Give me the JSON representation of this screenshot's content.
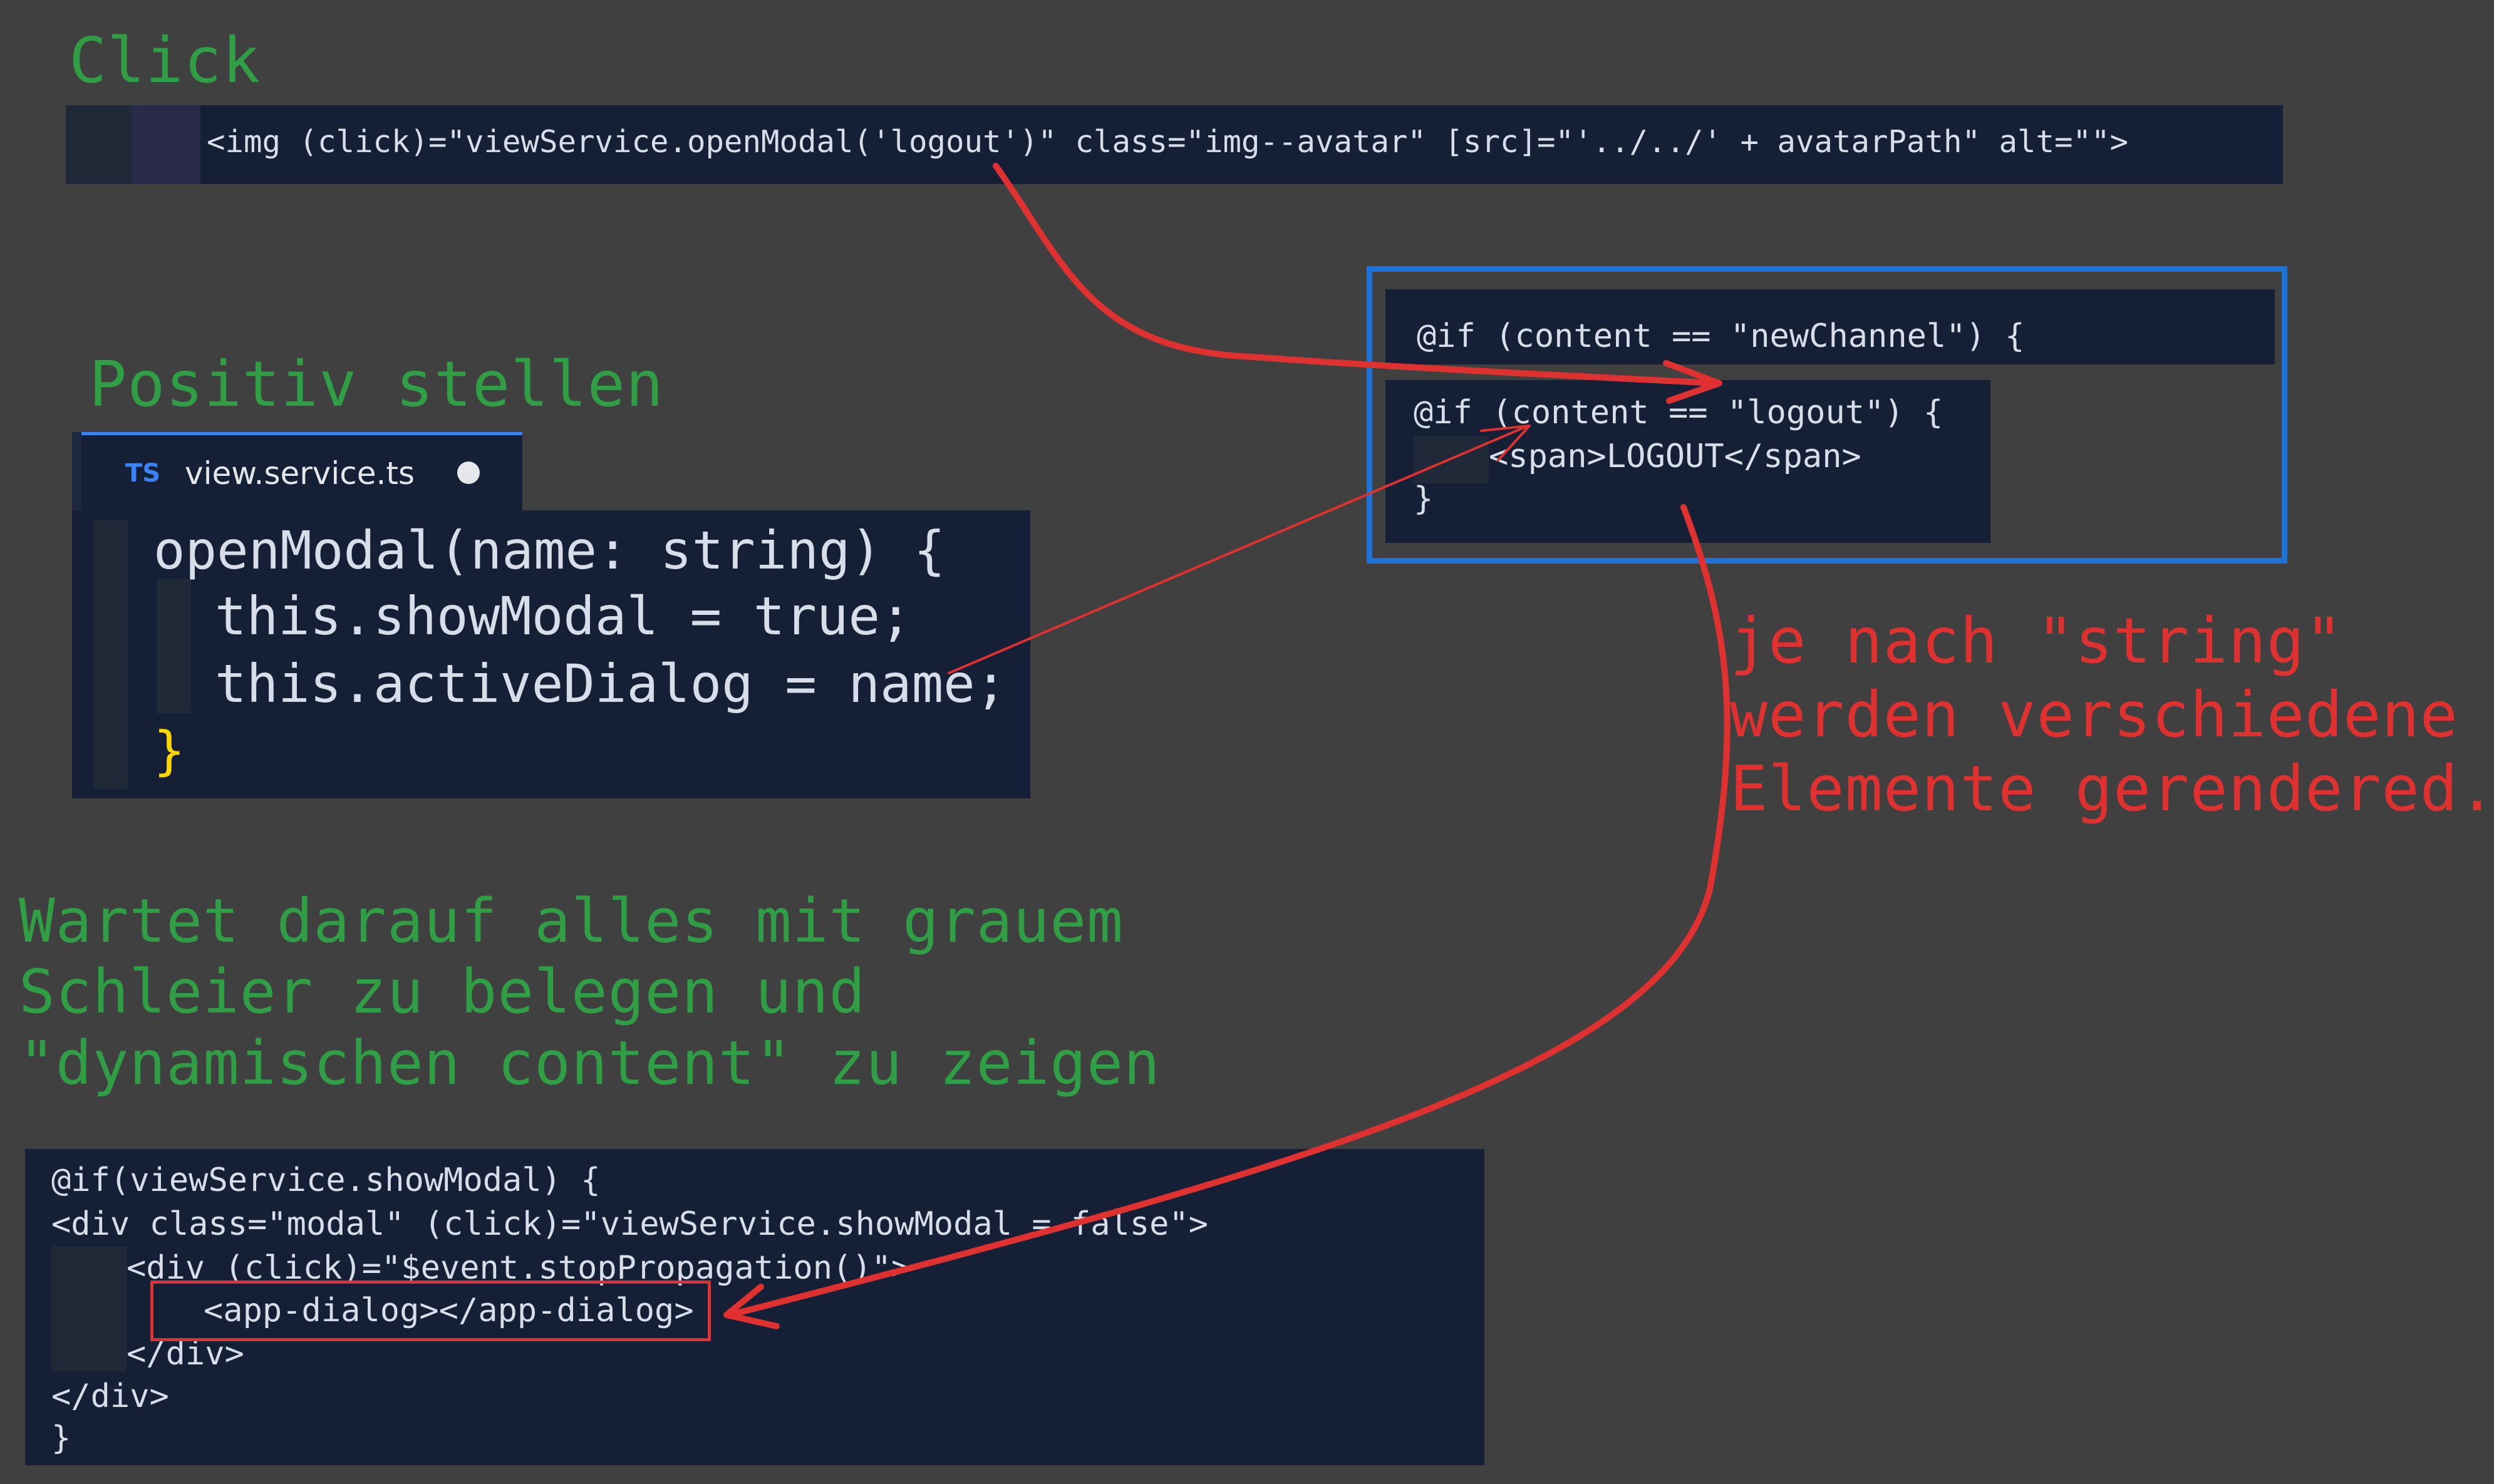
{
  "notes": {
    "click": "Click",
    "positiv": "Positiv stellen",
    "wartet": "Wartet darauf alles mit grauem\nSchleier zu belegen und\n\"dynamischen content\" zu zeigen",
    "je_nach": "je nach \"string\"\nwerden verschiedene\nElemente gerendered."
  },
  "snippet_click": {
    "l1": "<img (click)=\"viewService.openModal('logout')\" class=\"img--avatar\" [src]=\"'../../' + avatarPath\" alt=\"\">"
  },
  "tab": {
    "badge": "TS",
    "filename": "view.service.ts"
  },
  "snippet_service": {
    "l1": "openModal(name: string) {",
    "l2": "this.showModal = true;",
    "l3": "this.activeDialog = name;",
    "l4": "}"
  },
  "snippet_dialog": {
    "l1": "@if (content == \"newChannel\") {",
    "l2": "@if (content == \"logout\") {",
    "l3": "<span>LOGOUT</span>",
    "l4": "}"
  },
  "snippet_modal": {
    "l1": "@if(viewService.showModal) {",
    "l2": "<div class=\"modal\" (click)=\"viewService.showModal = false\">",
    "l3": "<div (click)=\"$event.stopPropagation()\">",
    "l4": "<app-dialog></app-dialog>",
    "l5": "</div>",
    "l6": "</div>",
    "l7": "}"
  },
  "colors": {
    "background": "#404040",
    "panel": "#152036",
    "note_green": "#2f9e44",
    "note_red": "#e03131",
    "highlight_box": "#1e73d8"
  },
  "icons": [
    "modified-dot-icon",
    "typescript-file-icon"
  ]
}
